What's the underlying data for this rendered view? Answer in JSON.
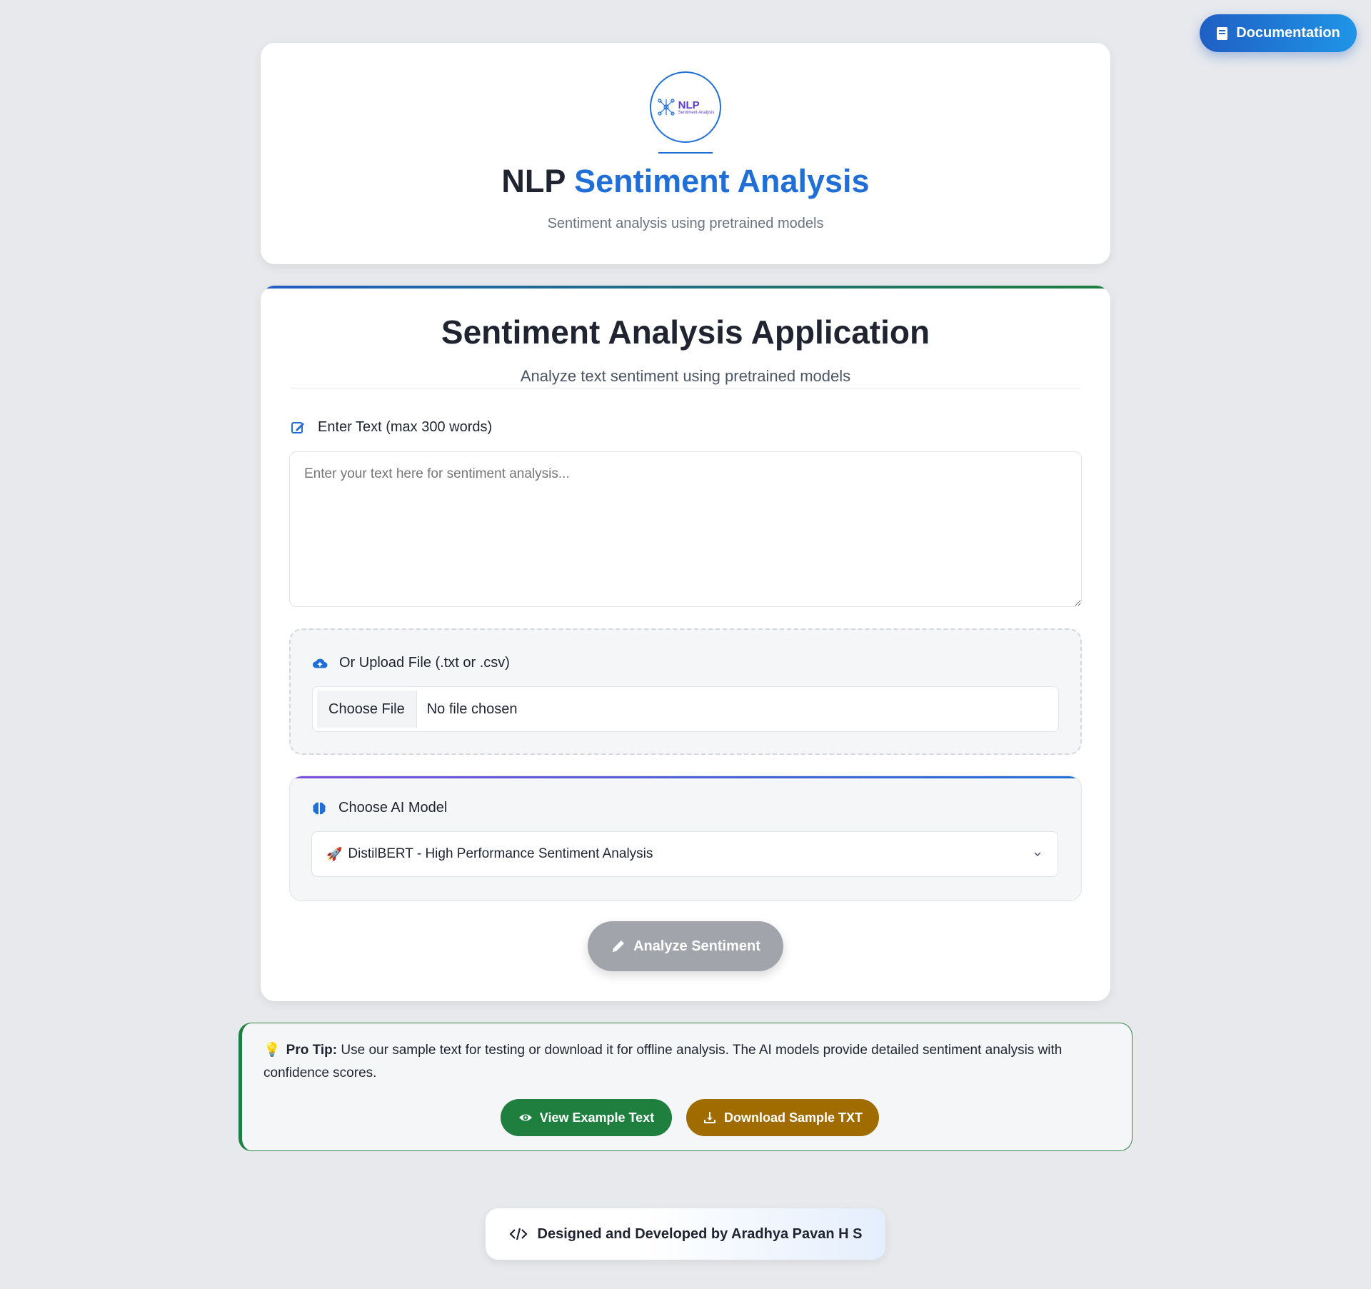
{
  "doc_button": {
    "label": "Documentation",
    "icon": "book-icon"
  },
  "header": {
    "logo": {
      "title": "NLP",
      "subtitle": "Sentiment Analysis"
    },
    "title_plain": "NLP",
    "title_accent": "Sentiment Analysis",
    "subtitle": "Sentiment analysis using pretrained models"
  },
  "app": {
    "title": "Sentiment Analysis Application",
    "subtitle": "Analyze text sentiment using pretrained models",
    "text_input": {
      "label": "Enter Text (max 300 words)",
      "placeholder": "Enter your text here for sentiment analysis...",
      "value": ""
    },
    "upload": {
      "label": "Or Upload File (.txt or .csv)",
      "choose_label": "Choose File",
      "status": "No file chosen"
    },
    "model": {
      "label": "Choose AI Model",
      "selected": "DistilBERT - High Performance Sentiment Analysis",
      "selected_icon": "🚀"
    },
    "analyze_label": "Analyze Sentiment"
  },
  "tip": {
    "emoji": "💡",
    "heading": "Pro Tip:",
    "text": " Use our sample text for testing or download it for offline analysis. The AI models provide detailed sentiment analysis with confidence scores.",
    "view_label": "View Example Text",
    "download_label": "Download Sample TXT"
  },
  "footer": {
    "text": "Designed and Developed by Aradhya Pavan H S"
  },
  "colors": {
    "accent": "#1f6fd6",
    "green": "#1e7f3e",
    "amber": "#a06c00",
    "disabled": "#a1a4ab",
    "background": "#e7e9ed"
  }
}
